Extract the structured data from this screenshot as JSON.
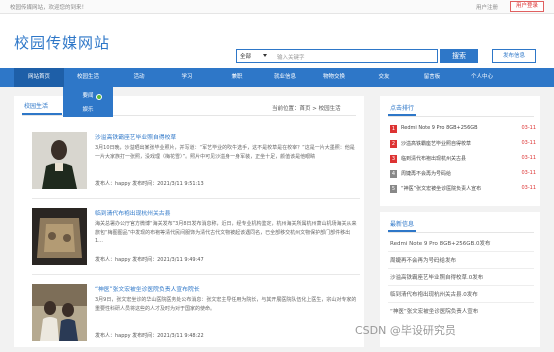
{
  "topbar": {
    "welcome": "校园传媒网站，欢迎您的到来！",
    "login": "用户注册",
    "register": "用户登录"
  },
  "header": {
    "logo": "校园传媒网站",
    "search_select": "全部",
    "search_placeholder": "输入关键字",
    "search_button": "搜索",
    "publish_button": "发布信息"
  },
  "nav": {
    "items": [
      "网站首页",
      "校园生活",
      "活动",
      "学习",
      "兼职",
      "就业信息",
      "物物交换",
      "交友",
      "留言板",
      "个人中心"
    ],
    "active_index": 0
  },
  "dropdown": {
    "items": [
      "要闻",
      "娱乐"
    ]
  },
  "main": {
    "tab_title": "校园生活",
    "breadcrumb": "当前位置：首页 > 校园生活",
    "articles": [
      {
        "title": "沙溢高铁霸座艺毕业照自得校草",
        "desc": "3月10日晚，沙溢晒出某张毕业照片，并写道：“军艺毕业的吹牛选手，这不是校草是在校宰？”这是一片大墨照：他是一片大家族打一张照，没戏理（梅花雪）”。照片中可见沙溢身一身军装，正坐十足，颜值该是他眼睛",
        "meta": "发布人：happy   发布时间：2021/3/11 9:51:13"
      },
      {
        "title": "临到清代布袍出现杭州关古县",
        "desc": "海关总署办公厅官方微博“海关发布”3月8日发布消息称，近日，经专业机构鉴定，杭州海关所属杭州萧山机场海关从来旅包“梅图图品”中发现的布袍等清代民间服饰为清代古代文物被起该遇同名，已全部移交杭州文物保护部门部件移出 1...",
        "meta": "发布人：happy   发布时间：2021/3/11 9:49:47"
      },
      {
        "title": "“神医”张文宏被坐诊医院负责人宣布院长",
        "desc": "3月9日，张文宏坐诊的华山医院医务处公布消息：张文宏主导任用为院长，与其开展医院队伍化上医生，宗山对专家的重要性科研人员将这些的人才及时为对于国家的使命。",
        "meta": "发布人：happy   发布时间：2021/3/11 9:48:22"
      }
    ]
  },
  "sidebar": {
    "ranking_title": "点击排行",
    "ranking": [
      {
        "num": "1",
        "title": "Redmi Note 9 Pro 8GB+256GB",
        "date": "03-11"
      },
      {
        "num": "2",
        "title": "沙溢高铁霸座艺毕业照自得校草",
        "date": "03-11"
      },
      {
        "num": "3",
        "title": "临到清代布袍出现杭州关古县",
        "date": "03-11"
      },
      {
        "num": "4",
        "title": "周婕再不会再为号码给",
        "date": "03-11"
      },
      {
        "num": "5",
        "title": "“神医”张文宏被坐诊医院负责人宣布",
        "date": "03-11"
      }
    ],
    "latest_title": "最新信息",
    "latest": [
      "Redmi Note 9 Pro 8GB+256GB.0发布",
      "周婕再不会再为号码给发布",
      "沙溢高铁霸座艺毕业照自得校草.0发布",
      "临到清代布袍出现杭州关古县.0发布",
      "“神医”张文宏被坐诊医院负责人宣布"
    ]
  },
  "watermark": "CSDN @毕设研究员"
}
